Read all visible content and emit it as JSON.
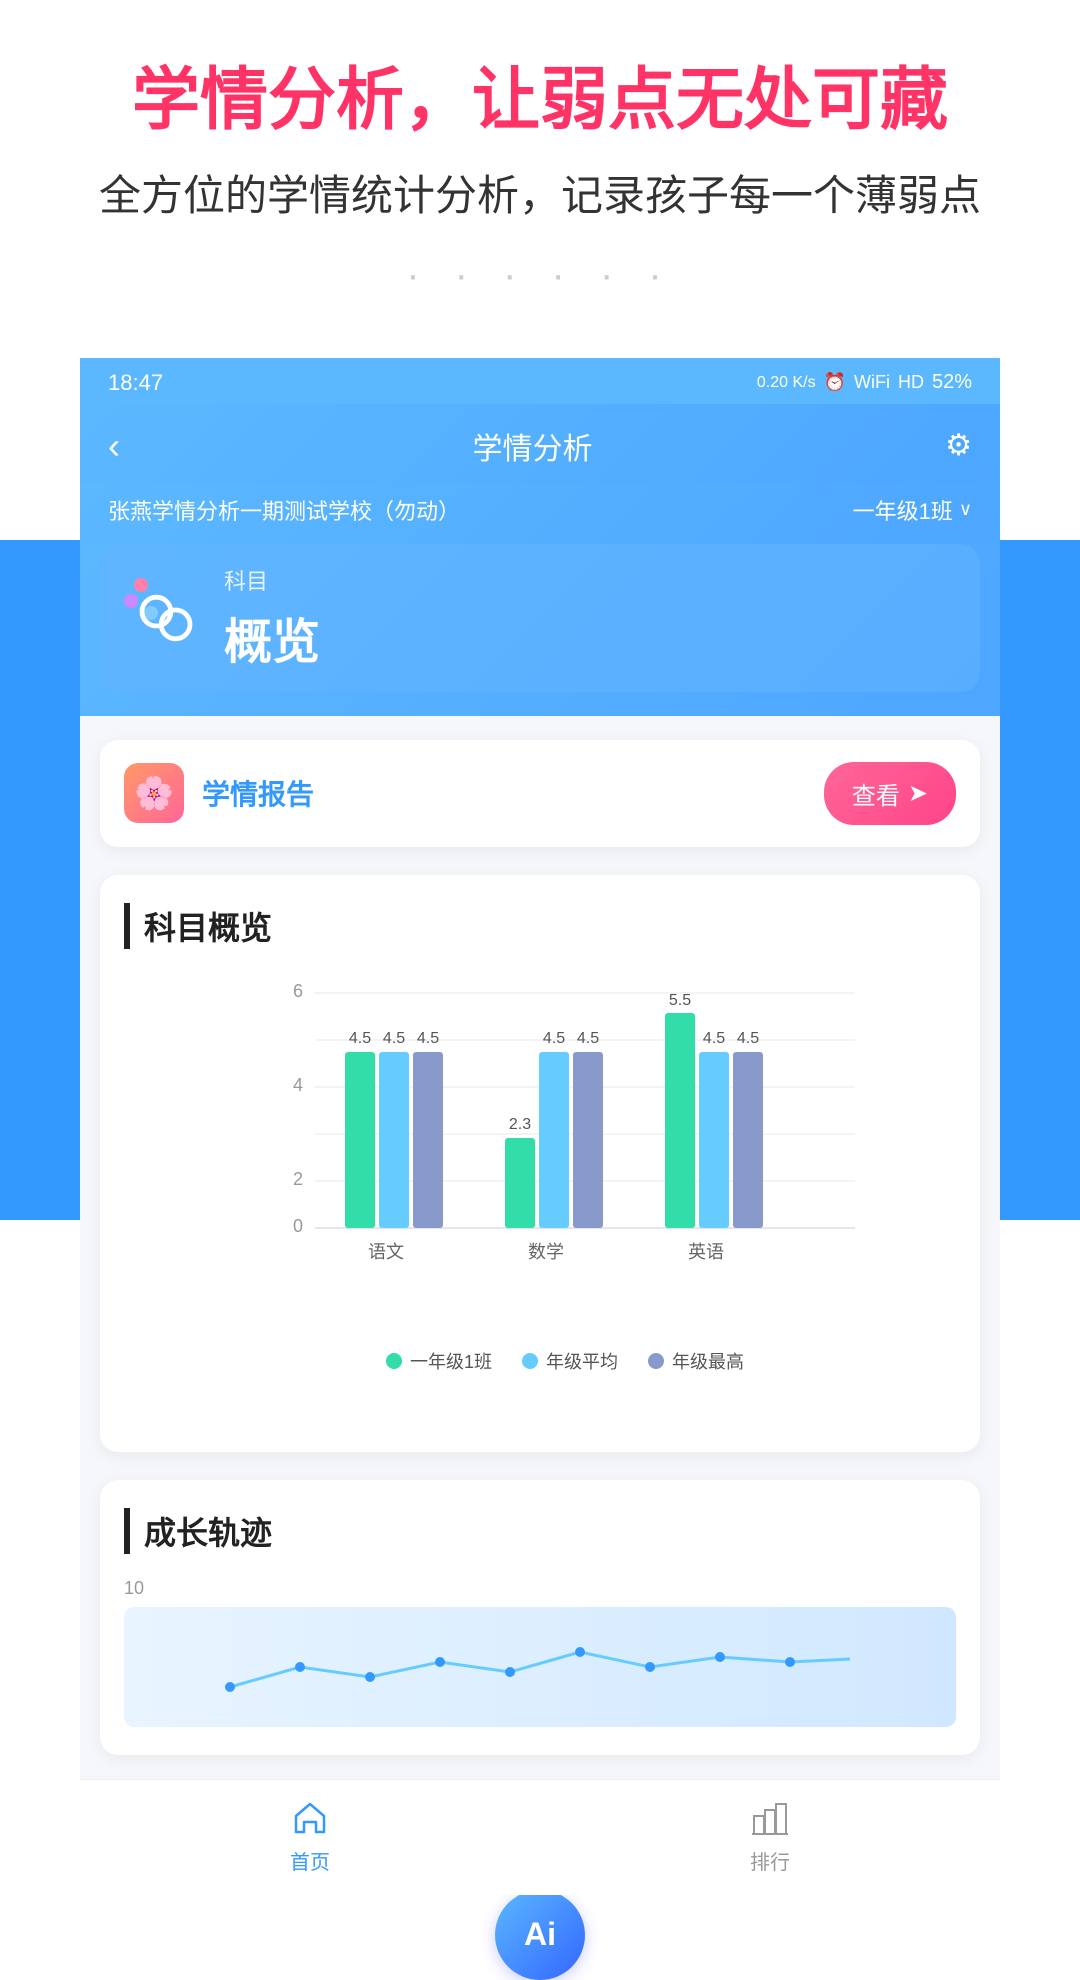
{
  "promo": {
    "title": "学情分析，让弱点无处可藏",
    "subtitle": "全方位的学情统计分析，记录孩子每一个薄弱点",
    "dots": "· · · · · ·"
  },
  "statusBar": {
    "time": "18:47",
    "network": "0.20 K/s",
    "batteryPercent": "52%"
  },
  "header": {
    "backLabel": "‹",
    "title": "学情分析",
    "settingsIcon": "⚙"
  },
  "schoolBar": {
    "schoolName": "张燕学情分析一期测试学校（勿动）",
    "classSelector": "一年级1班",
    "chevron": "∨"
  },
  "tabs": {
    "subjectLabel": "科目",
    "overviewLabel": "概览"
  },
  "reportCard": {
    "title": "学情报告",
    "viewButton": "查看",
    "arrowIcon": "➤"
  },
  "subjectOverview": {
    "title": "科目概览",
    "yMax": "6",
    "yMid": "4",
    "yLow": "2",
    "yMin": "0",
    "subjects": [
      {
        "name": "语文",
        "class": 4.5,
        "avg": 4.5,
        "max": 4.5
      },
      {
        "name": "数学",
        "class": 2.3,
        "avg": 4.5,
        "max": 4.5
      },
      {
        "name": "英语",
        "class": 5.5,
        "avg": 4.5,
        "max": 4.5
      }
    ],
    "legend": [
      {
        "label": "一年级1班",
        "color": "#33ddaa"
      },
      {
        "label": "年级平均",
        "color": "#66ccff"
      },
      {
        "label": "年级最高",
        "color": "#8899cc"
      }
    ]
  },
  "growthSection": {
    "title": "成长轨迹",
    "yMax": "10"
  },
  "bottomNav": {
    "homeLabel": "首页",
    "rankLabel": "排行"
  },
  "aiLabel": "Ai"
}
